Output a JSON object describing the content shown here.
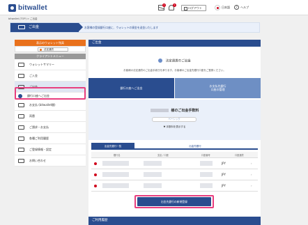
{
  "header": {
    "logo_text": "bitwallet",
    "mail_badge": "1",
    "bell_badge": "1",
    "logout_label": "ログアウト",
    "language_label": "日本語",
    "help_label": "ヘルプ"
  },
  "breadcrumb": "bitwallet (TOP) > ご出金",
  "banner": {
    "title": "ご出金",
    "message": "お客様の登録銀行口座に、ウォレットの資金を送金いたします"
  },
  "sidebar": {
    "wallet_select_label": "表示のウォレット残高",
    "wallet_select_value": "法定通貨",
    "menu_header": "クライアントメニュー",
    "items": [
      {
        "label": "ウォレットサマリー",
        "icon": "wallet-icon"
      },
      {
        "label": "ご入金",
        "icon": "deposit-icon"
      },
      {
        "label": "ご出金",
        "icon": "withdraw-icon"
      },
      {
        "label": "銀行口座へご出金",
        "icon": "bank-icon"
      },
      {
        "label": "お支払 (bitwallet間)",
        "icon": "transfer-icon"
      },
      {
        "label": "両替",
        "icon": "exchange-icon"
      },
      {
        "label": "ご請求・お支払",
        "icon": "invoice-icon"
      },
      {
        "label": "各種ご利用履歴",
        "icon": "history-icon"
      },
      {
        "label": "ご登録情報・設定",
        "icon": "gear-icon"
      },
      {
        "label": "お問い合わせ",
        "icon": "help-icon"
      }
    ]
  },
  "main": {
    "panel_title": "ご出金",
    "section_head": "法定通貨のご出金",
    "section_desc": "お客様の法定通貨のご出金手続きを承ります。お客様のご出金先銀行口座をご登録ください。",
    "tab_bank": "銀行口座へご出金",
    "tab_register_line1": "お支払先銀行",
    "tab_register_line2": "口座の管理",
    "fee_title_suffix": "様のご出金手数料",
    "fee_tag": "ベーシック",
    "fee_toggle": "▼ 手数料を表示する",
    "acct_tab_active": "出金先銀行一覧",
    "acct_tab_other": "出金先銀行",
    "table_headers": [
      "銀行名",
      "支店 / 口座",
      "",
      "口座番号",
      "口座通貨"
    ],
    "rows": [
      {
        "currency": "JPY",
        "arrow": "›"
      },
      {
        "currency": "JPY",
        "arrow": "›"
      },
      {
        "currency": "JPY",
        "arrow": "›"
      }
    ],
    "register_button": "出金先銀行の新規登録"
  },
  "history_title": "ご利用履歴",
  "colors": {
    "brand_blue": "#2a4d8f",
    "accent_orange": "#e9711c",
    "highlight_pink": "#e83e7e"
  }
}
